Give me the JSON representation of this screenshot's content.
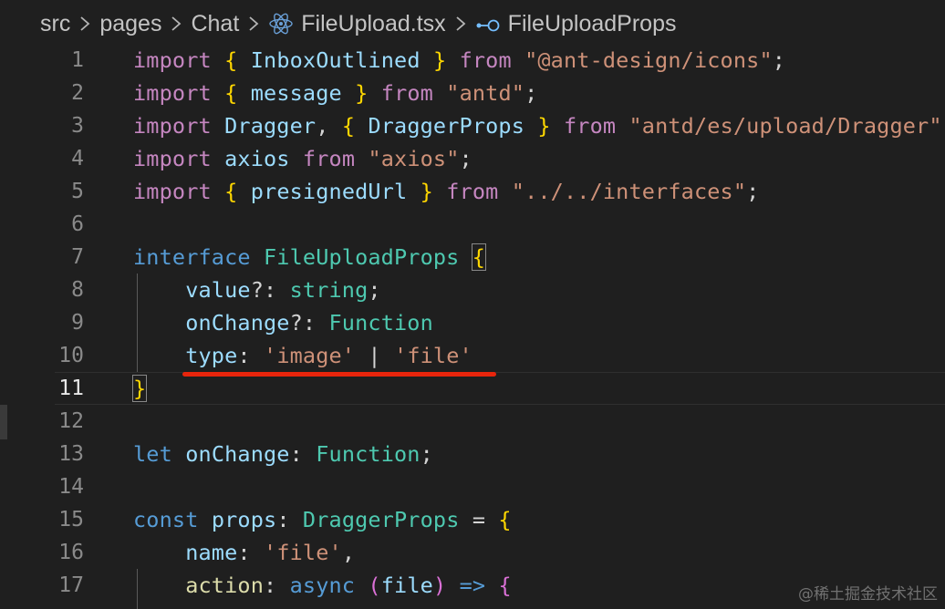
{
  "breadcrumb": {
    "items": [
      "src",
      "pages",
      "Chat",
      "FileUpload.tsx",
      "FileUploadProps"
    ]
  },
  "lines": [
    {
      "n": "1",
      "tokens": [
        [
          "kw",
          "import"
        ],
        [
          "pl",
          " "
        ],
        [
          "br",
          "{"
        ],
        [
          "pl",
          " "
        ],
        [
          "id",
          "InboxOutlined"
        ],
        [
          "pl",
          " "
        ],
        [
          "br",
          "}"
        ],
        [
          "pl",
          " "
        ],
        [
          "kw",
          "from"
        ],
        [
          "pl",
          " "
        ],
        [
          "str",
          "\"@ant-design/icons\""
        ],
        [
          "pl",
          ";"
        ]
      ]
    },
    {
      "n": "2",
      "tokens": [
        [
          "kw",
          "import"
        ],
        [
          "pl",
          " "
        ],
        [
          "br",
          "{"
        ],
        [
          "pl",
          " "
        ],
        [
          "id",
          "message"
        ],
        [
          "pl",
          " "
        ],
        [
          "br",
          "}"
        ],
        [
          "pl",
          " "
        ],
        [
          "kw",
          "from"
        ],
        [
          "pl",
          " "
        ],
        [
          "str",
          "\"antd\""
        ],
        [
          "pl",
          ";"
        ]
      ]
    },
    {
      "n": "3",
      "tokens": [
        [
          "kw",
          "import"
        ],
        [
          "pl",
          " "
        ],
        [
          "id",
          "Dragger"
        ],
        [
          "pl",
          ", "
        ],
        [
          "br",
          "{"
        ],
        [
          "pl",
          " "
        ],
        [
          "id",
          "DraggerProps"
        ],
        [
          "pl",
          " "
        ],
        [
          "br",
          "}"
        ],
        [
          "pl",
          " "
        ],
        [
          "kw",
          "from"
        ],
        [
          "pl",
          " "
        ],
        [
          "str",
          "\"antd/es/upload/Dragger\""
        ]
      ]
    },
    {
      "n": "4",
      "tokens": [
        [
          "kw",
          "import"
        ],
        [
          "pl",
          " "
        ],
        [
          "id",
          "axios"
        ],
        [
          "pl",
          " "
        ],
        [
          "kw",
          "from"
        ],
        [
          "pl",
          " "
        ],
        [
          "str",
          "\"axios\""
        ],
        [
          "pl",
          ";"
        ]
      ]
    },
    {
      "n": "5",
      "tokens": [
        [
          "kw",
          "import"
        ],
        [
          "pl",
          " "
        ],
        [
          "br",
          "{"
        ],
        [
          "pl",
          " "
        ],
        [
          "id",
          "presignedUrl"
        ],
        [
          "pl",
          " "
        ],
        [
          "br",
          "}"
        ],
        [
          "pl",
          " "
        ],
        [
          "kw",
          "from"
        ],
        [
          "pl",
          " "
        ],
        [
          "str",
          "\"../../interfaces\""
        ],
        [
          "pl",
          ";"
        ]
      ]
    },
    {
      "n": "6",
      "tokens": []
    },
    {
      "n": "7",
      "tokens": [
        [
          "kw2",
          "interface"
        ],
        [
          "pl",
          " "
        ],
        [
          "ty",
          "FileUploadProps"
        ],
        [
          "pl",
          " "
        ],
        [
          "brbox",
          "{"
        ]
      ]
    },
    {
      "n": "8",
      "tokens": [
        [
          "pl",
          "    "
        ],
        [
          "id",
          "value"
        ],
        [
          "pl",
          "?: "
        ],
        [
          "ty",
          "string"
        ],
        [
          "pl",
          ";"
        ]
      ]
    },
    {
      "n": "9",
      "tokens": [
        [
          "pl",
          "    "
        ],
        [
          "id",
          "onChange"
        ],
        [
          "pl",
          "?: "
        ],
        [
          "ty",
          "Function"
        ]
      ]
    },
    {
      "n": "10",
      "tokens": [
        [
          "pl",
          "    "
        ],
        [
          "id",
          "type"
        ],
        [
          "pl",
          ": "
        ],
        [
          "str",
          "'image'"
        ],
        [
          "pl",
          " | "
        ],
        [
          "str",
          "'file'"
        ]
      ]
    },
    {
      "n": "11",
      "tokens": [
        [
          "brbox",
          "}"
        ]
      ],
      "active": true
    },
    {
      "n": "12",
      "tokens": []
    },
    {
      "n": "13",
      "tokens": [
        [
          "kw2",
          "let"
        ],
        [
          "pl",
          " "
        ],
        [
          "id",
          "onChange"
        ],
        [
          "pl",
          ": "
        ],
        [
          "ty",
          "Function"
        ],
        [
          "pl",
          ";"
        ]
      ]
    },
    {
      "n": "14",
      "tokens": []
    },
    {
      "n": "15",
      "tokens": [
        [
          "kw2",
          "const"
        ],
        [
          "pl",
          " "
        ],
        [
          "id",
          "props"
        ],
        [
          "pl",
          ": "
        ],
        [
          "ty",
          "DraggerProps"
        ],
        [
          "pl",
          " = "
        ],
        [
          "br",
          "{"
        ]
      ]
    },
    {
      "n": "16",
      "tokens": [
        [
          "pl",
          "    "
        ],
        [
          "id",
          "name"
        ],
        [
          "pl",
          ": "
        ],
        [
          "str",
          "'file'"
        ],
        [
          "pl",
          ","
        ]
      ]
    },
    {
      "n": "17",
      "tokens": [
        [
          "pl",
          "    "
        ],
        [
          "fn",
          "action"
        ],
        [
          "pl",
          ": "
        ],
        [
          "kw2",
          "async"
        ],
        [
          "pl",
          " "
        ],
        [
          "br2",
          "("
        ],
        [
          "id",
          "file"
        ],
        [
          "br2",
          ")"
        ],
        [
          "pl",
          " "
        ],
        [
          "kw2",
          "=>"
        ],
        [
          "pl",
          " "
        ],
        [
          "br2",
          "{"
        ]
      ]
    }
  ],
  "watermark": "@稀土掘金技术社区",
  "colors": {
    "background": "#1f1f1f",
    "keyword": "#c586c0",
    "storage": "#569cd6",
    "bracket": "#ffd700",
    "identifier": "#9cdcfe",
    "type": "#4ec9b0",
    "string": "#ce9178",
    "annotation_underline": "#e8250c"
  }
}
